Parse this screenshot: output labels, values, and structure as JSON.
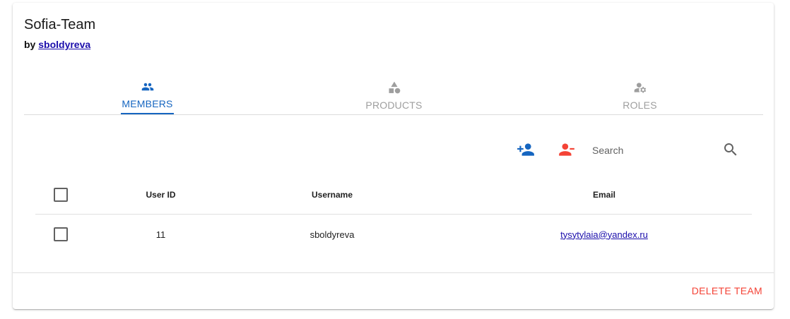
{
  "team": {
    "name": "Sofia-Team",
    "by_prefix": "by",
    "owner": "sboldyreva"
  },
  "tabs": [
    {
      "label": "MEMBERS",
      "icon": "people-icon",
      "active": true
    },
    {
      "label": "PRODUCTS",
      "icon": "category-shapes-icon",
      "active": false
    },
    {
      "label": "ROLES",
      "icon": "manage-accounts-icon",
      "active": false
    }
  ],
  "toolbar": {
    "add_member_icon": "person-add-icon",
    "remove_member_icon": "person-remove-icon",
    "search_placeholder": "Search",
    "search_value": "",
    "search_icon": "search-icon"
  },
  "table": {
    "columns": [
      "User ID",
      "Username",
      "Email"
    ],
    "rows": [
      {
        "user_id": "11",
        "username": "sboldyreva",
        "email": "tysytylaia@yandex.ru",
        "selected": false
      }
    ]
  },
  "footer": {
    "delete_label": "DELETE TEAM"
  },
  "colors": {
    "accent": "#1565c0",
    "danger": "#f44336",
    "inactive": "#9e9e9e",
    "link": "#1a0dab"
  }
}
